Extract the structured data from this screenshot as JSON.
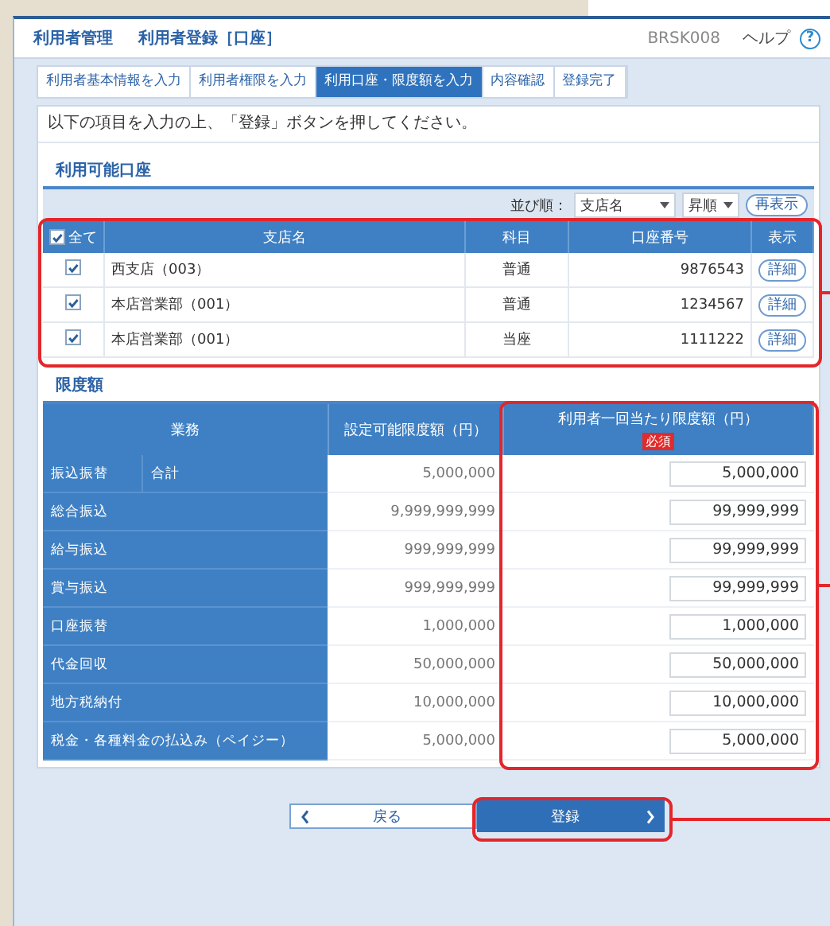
{
  "header": {
    "section": "利用者管理",
    "title": "利用者登録［口座］",
    "screen_id": "BRSK008",
    "help": "ヘルプ",
    "help_icon": "?"
  },
  "steps": [
    {
      "label": "利用者基本情報を入力",
      "selected": false
    },
    {
      "label": "利用者権限を入力",
      "selected": false
    },
    {
      "label": "利用口座・限度額を入力",
      "selected": true
    },
    {
      "label": "内容確認",
      "selected": false
    },
    {
      "label": "登録完了",
      "selected": false
    }
  ],
  "instruction": "以下の項目を入力の上、「登録」ボタンを押してください。",
  "accounts": {
    "title": "利用可能口座",
    "sort_label": "並び順：",
    "sort_field": "支店名",
    "sort_order": "昇順",
    "refresh": "再表示",
    "select_all": {
      "label": "全て",
      "checked": true
    },
    "columns": [
      "支店名",
      "科目",
      "口座番号",
      "表示"
    ],
    "rows": [
      {
        "checked": true,
        "branch": "西支店（003）",
        "type": "普通",
        "number": "9876543",
        "action": "詳細"
      },
      {
        "checked": true,
        "branch": "本店営業部（001）",
        "type": "普通",
        "number": "1234567",
        "action": "詳細"
      },
      {
        "checked": true,
        "branch": "本店営業部（001）",
        "type": "当座",
        "number": "1111222",
        "action": "詳細"
      }
    ]
  },
  "limits": {
    "title": "限度額",
    "columns": [
      "業務",
      "設定可能限度額（円）",
      "利用者一回当たり限度額（円）"
    ],
    "required": "必須",
    "rows": [
      {
        "service": "振込振替",
        "sub": "合計",
        "max": "5,000,000",
        "value": "5,000,000"
      },
      {
        "service": "総合振込",
        "max": "9,999,999,999",
        "value": "99,999,999"
      },
      {
        "service": "給与振込",
        "max": "999,999,999",
        "value": "99,999,999"
      },
      {
        "service": "賞与振込",
        "max": "999,999,999",
        "value": "99,999,999"
      },
      {
        "service": "口座振替",
        "max": "1,000,000",
        "value": "1,000,000"
      },
      {
        "service": "代金回収",
        "max": "50,000,000",
        "value": "50,000,000"
      },
      {
        "service": "地方税納付",
        "max": "10,000,000",
        "value": "10,000,000"
      },
      {
        "service": "税金・各種料金の払込み（ペイジー）",
        "max": "5,000,000",
        "value": "5,000,000"
      }
    ]
  },
  "buttons": {
    "back": "戻る",
    "submit": "登録"
  }
}
